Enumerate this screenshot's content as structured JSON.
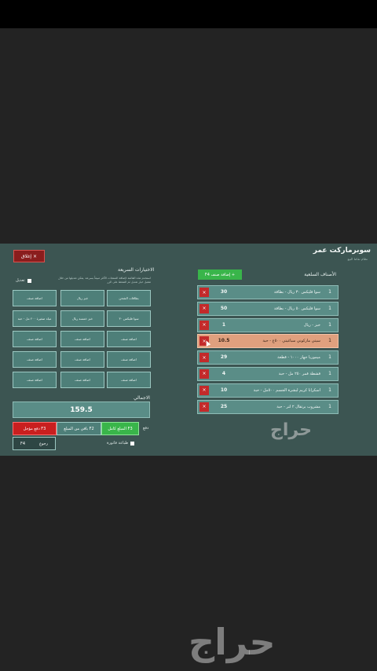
{
  "app": {
    "title": "سوبرماركت عمر",
    "subtitle": "نظام نقاط البيع",
    "close_label": "إغلاق"
  },
  "cart": {
    "title": "الأصناف السلعية",
    "add_category_label": "+ إضافة صنف F4",
    "items": [
      {
        "qty": "1",
        "name": "سوا فليكس ٣٠ ريال - بطاقة",
        "price": "30",
        "selected": false
      },
      {
        "qty": "1",
        "name": "سوا فليكس ٥٠ ريال - بطاقة",
        "price": "50",
        "selected": false
      },
      {
        "qty": "1",
        "name": "خبز - ريال",
        "price": "1",
        "selected": false
      },
      {
        "qty": "1",
        "name": "سيتي ماركوني سباغيتي ٥٠٠غ - حبة",
        "price": "10.5",
        "selected": true
      },
      {
        "qty": "1",
        "name": "ميموريا جهاز ١٠٠٠ - قطعة",
        "price": "29",
        "selected": false
      },
      {
        "qty": "1",
        "name": "قشطة قمر ٢٥٠ مل - حبة",
        "price": "4",
        "selected": false
      },
      {
        "qty": "1",
        "name": "اسكرانا كريم لبشرة الجسم ٥٠٠مل - حبة",
        "price": "10",
        "selected": false
      },
      {
        "qty": "1",
        "name": "مشروب برتقال ٢ لتر - حبة",
        "price": "25",
        "selected": false
      }
    ]
  },
  "quick": {
    "title": "الاختيارات السريعة",
    "description": "استخدم هذه القائمة لإضافة المنتجات الأكثر مبيعاً بسرعة. يمكن تعديلها من خلال تفعيل خيار تعديل ثم الضغط على الزر",
    "edit_label": "تعديل",
    "buttons": [
      [
        "بطاقات الشحن",
        "خبز ريال",
        "اضافة صنف"
      ],
      [
        "سوا فليكس ٣٠",
        "خبز خمسة ريال",
        "مياه صغيرة ٢٠٠ مل - حبة"
      ],
      [
        "اضافة صنف",
        "اضافة صنف",
        "اضافة صنف"
      ],
      [
        "اضافة صنف",
        "اضافة صنف",
        "اضافة صنف"
      ],
      [
        "اضافة صنف",
        "اضافة صنف",
        "اضافة صنف"
      ]
    ]
  },
  "totals": {
    "label": "الاجمالي",
    "value": "159.5"
  },
  "payment": {
    "label": "دفع",
    "full_label": "F3 المبلغ كامل",
    "rest_label": "F2 باقي من المبلغ",
    "later_label": "F3 دفع مؤجل",
    "return_label": "رجوع",
    "return_key": "F4",
    "print_label": "طباعة فاتورة"
  },
  "watermark": {
    "text": "حراج"
  }
}
